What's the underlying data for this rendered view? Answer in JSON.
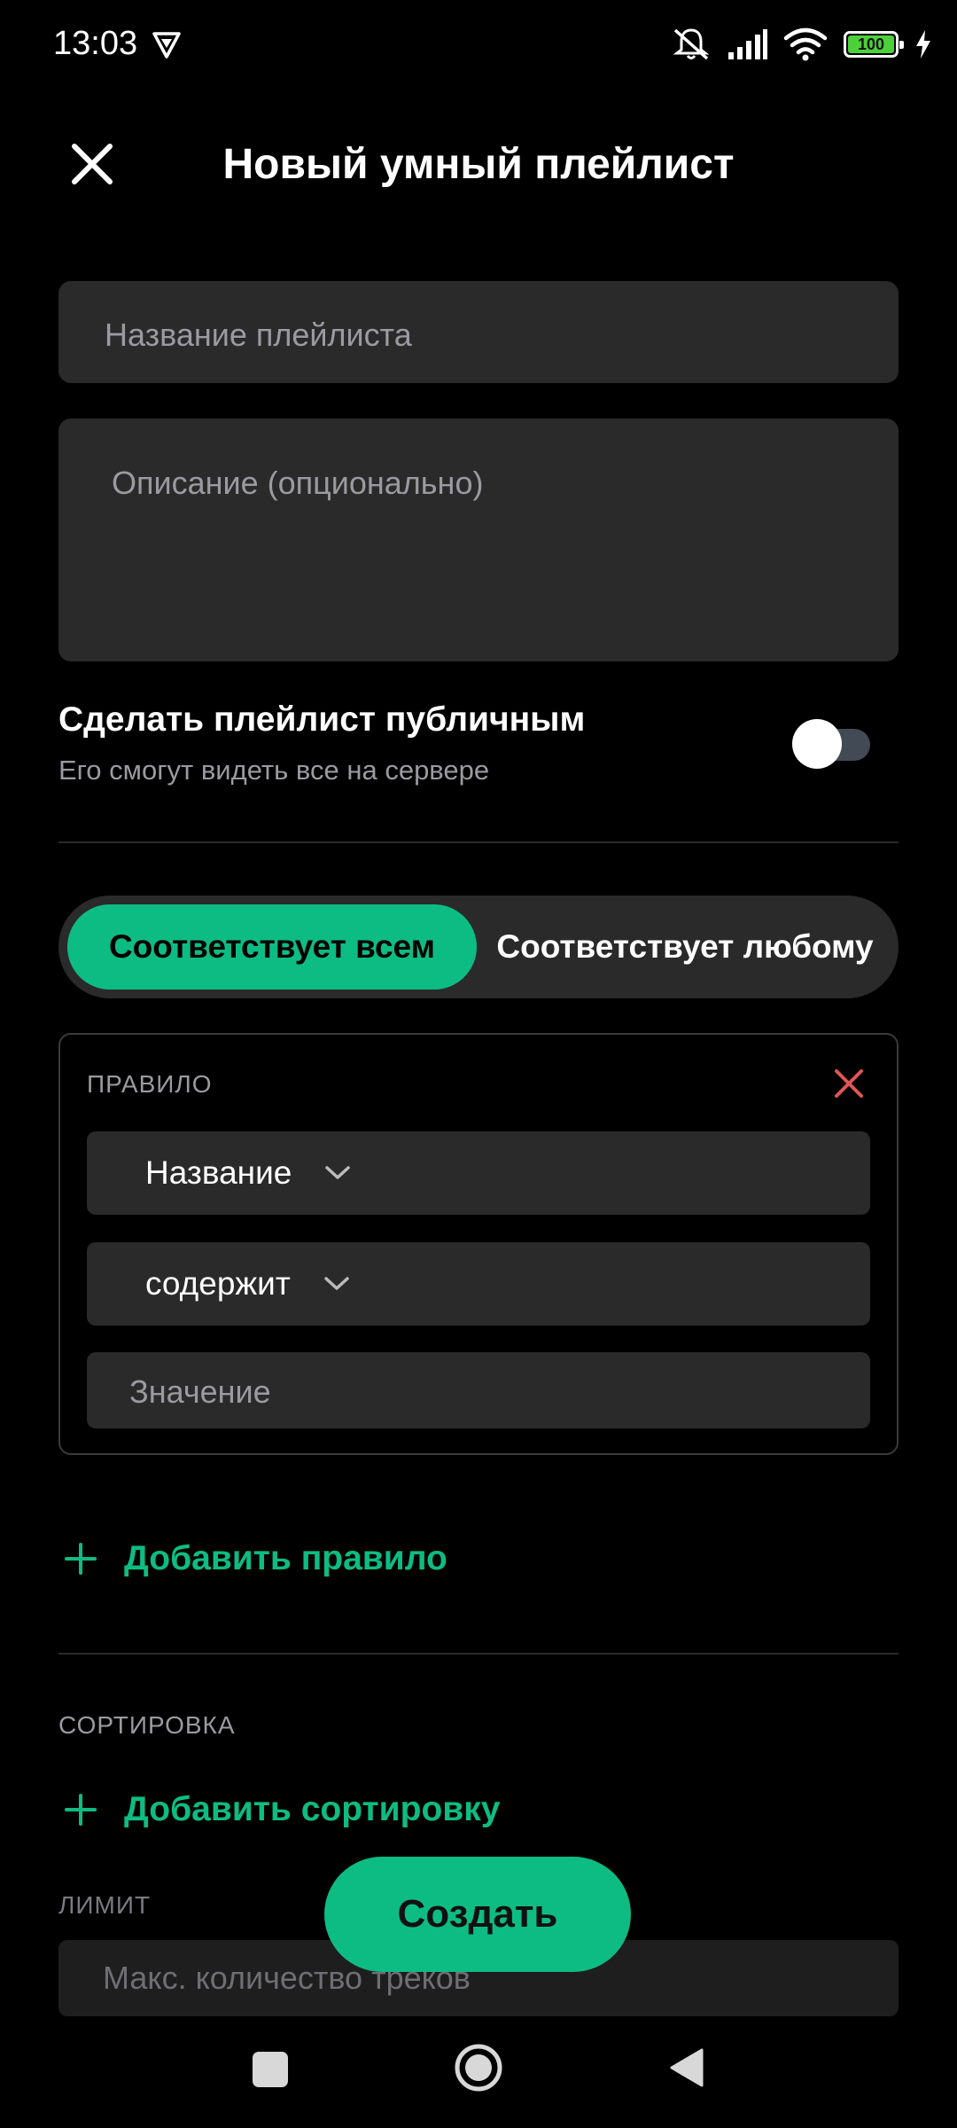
{
  "status_bar": {
    "time": "13:03",
    "battery": "100"
  },
  "header": {
    "title": "Новый умный плейлист"
  },
  "form": {
    "name_placeholder": "Название плейлиста",
    "description_placeholder": "Описание (опционально)",
    "public_title": "Сделать плейлист публичным",
    "public_subtitle": "Его смогут видеть все на сервере",
    "public_enabled": false
  },
  "match": {
    "all_label": "Соответствует всем",
    "any_label": "Соответствует любому",
    "selected": "all"
  },
  "rule": {
    "label": "ПРАВИЛО",
    "field": "Название",
    "operator": "содержит",
    "value_placeholder": "Значение"
  },
  "add_rule_label": "Добавить правило",
  "sorting": {
    "label": "СОРТИРОВКА",
    "add_label": "Добавить сортировку"
  },
  "limit": {
    "label": "ЛИМИТ",
    "placeholder": "Макс. количество треков"
  },
  "create_label": "Создать",
  "colors": {
    "accent": "#0dbc82",
    "remove": "#e05555",
    "surface": "#2a2a2a"
  }
}
